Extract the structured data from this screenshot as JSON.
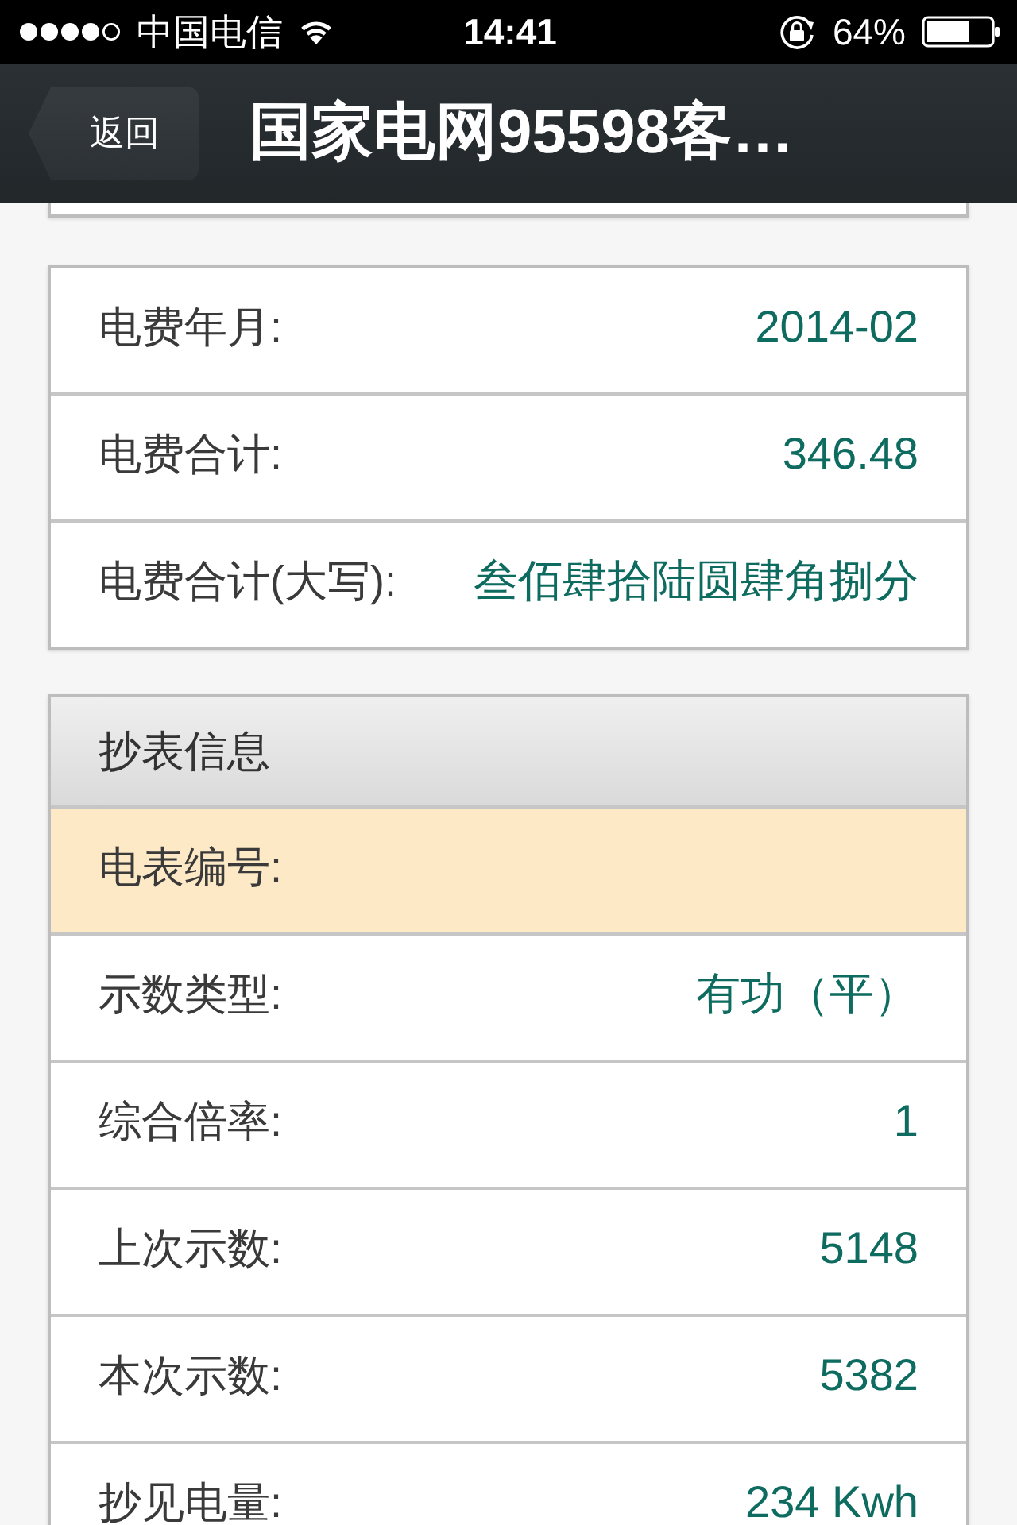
{
  "status_bar": {
    "carrier": "中国电信",
    "time": "14:41",
    "battery": "64%"
  },
  "nav_bar": {
    "back_button": "返回",
    "title": "国家电网95598客…"
  },
  "sections": [
    {
      "rows": [
        {
          "label": "电费年月:",
          "value": "2014-02"
        },
        {
          "label": "电费合计:",
          "value": "346.48"
        },
        {
          "label": "电费合计(大写):",
          "value": "叁佰肆拾陆圆肆角捌分"
        }
      ]
    },
    {
      "header": "抄表信息",
      "rows": [
        {
          "label": "电表编号:",
          "highlighted": true
        },
        {
          "label": "示数类型:",
          "value": "有功（平）",
          "highlighted": false
        },
        {
          "label": "综合倍率:",
          "value": "1",
          "highlighted": false
        },
        {
          "label": "上次示数:",
          "value": "5148",
          "highlighted": false
        },
        {
          "label": "本次示数:",
          "value": "5382",
          "highlighted": false
        },
        {
          "label": "抄见电量:",
          "value": "234 Kwh",
          "highlighted": false
        }
      ]
    }
  ]
}
